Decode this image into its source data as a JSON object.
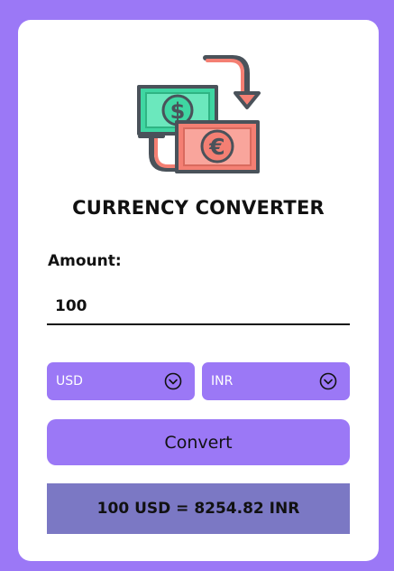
{
  "app": {
    "title": "CURRENCY CONVERTER"
  },
  "amount": {
    "label": "Amount:",
    "value": "100"
  },
  "currency": {
    "from": "USD",
    "to": "INR"
  },
  "buttons": {
    "convert_label": "Convert"
  },
  "result": {
    "text": "100 USD = 8254.82 INR"
  },
  "icons": {
    "illustration": "currency-exchange-icon",
    "dollar_symbol": "$",
    "euro_symbol": "€",
    "dropdown": "chevron-down-circle-icon"
  },
  "colors": {
    "background": "#9b78f6",
    "card": "#ffffff",
    "accent": "#9b78f6",
    "result_bg": "#7b78c4",
    "dollar_bill": "#3fd6a2",
    "euro_bill": "#f47f73"
  }
}
